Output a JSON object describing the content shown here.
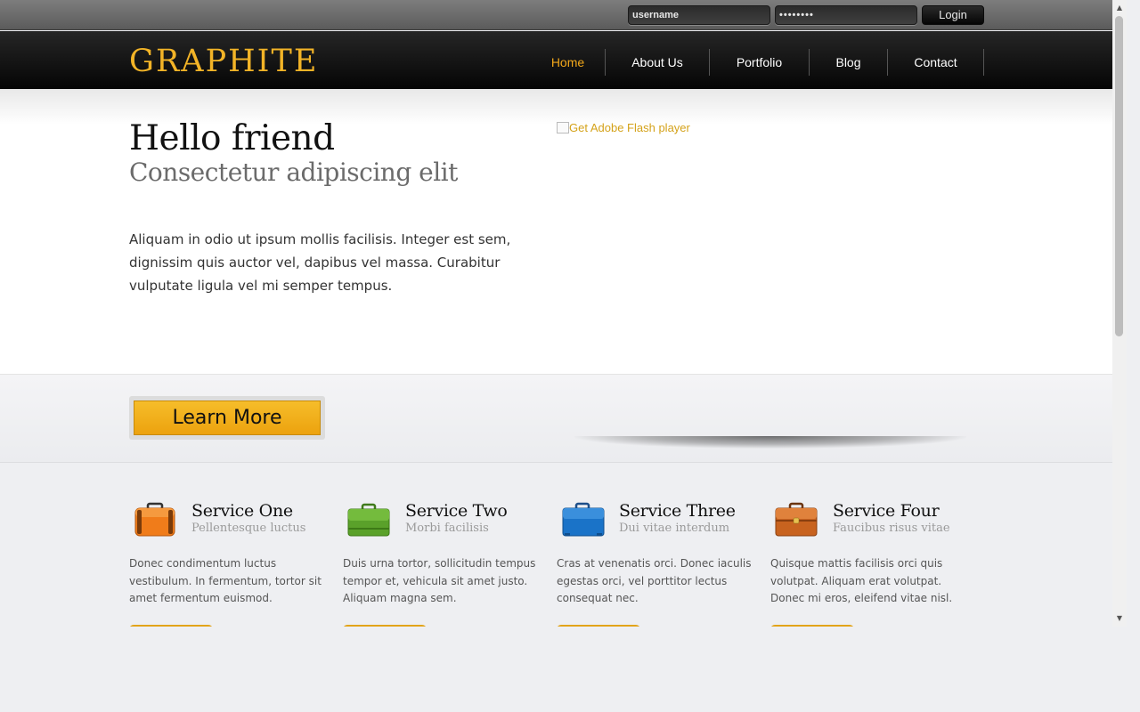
{
  "login": {
    "username_value": "username",
    "password_value": "••••••••",
    "login_label": "Login"
  },
  "header": {
    "logo": "GRAPHITE",
    "nav": [
      {
        "label": "Home",
        "active": true
      },
      {
        "label": "About Us",
        "active": false
      },
      {
        "label": "Portfolio",
        "active": false
      },
      {
        "label": "Blog",
        "active": false
      },
      {
        "label": "Contact",
        "active": false
      }
    ]
  },
  "hero": {
    "title": "Hello friend",
    "subtitle": "Consectetur adipiscing elit",
    "text": "Aliquam in odio ut ipsum mollis facilisis. Integer est sem, dignissim quis auctor vel, dapibus vel massa. Curabitur vulputate ligula vel mi semper tempus.",
    "flash_alt": "Get Adobe Flash player"
  },
  "cta": {
    "learn_more_label": "Learn More"
  },
  "services": [
    {
      "title": "Service One",
      "subtitle": "Pellentesque luctus",
      "text": "Donec condimentum luctus vestibulum. In fermentum, tortor sit amet fermentum euismod.",
      "icon": "orange-suitcase-icon",
      "color": "#f07c1a"
    },
    {
      "title": "Service Two",
      "subtitle": "Morbi facilisis",
      "text": "Duis urna tortor, sollicitudin tempus tempor et, vehicula sit amet justo. Aliquam magna sem.",
      "icon": "green-briefcase-icon",
      "color": "#5aa12a"
    },
    {
      "title": "Service Three",
      "subtitle": "Dui vitae interdum",
      "text": "Cras at venenatis orci. Donec iaculis egestas orci, vel porttitor lectus consequat nec.",
      "icon": "blue-briefcase-icon",
      "color": "#1a73c8"
    },
    {
      "title": "Service Four",
      "subtitle": "Faucibus risus vitae",
      "text": "Quisque mattis facilisis orci quis volutpat. Aliquam erat volutpat. Donec mi eros, eleifend vitae nisl.",
      "icon": "brown-briefcase-icon",
      "color": "#c8631f"
    }
  ],
  "colors": {
    "accent": "#f3b427",
    "nav_active": "#f3a81a"
  }
}
